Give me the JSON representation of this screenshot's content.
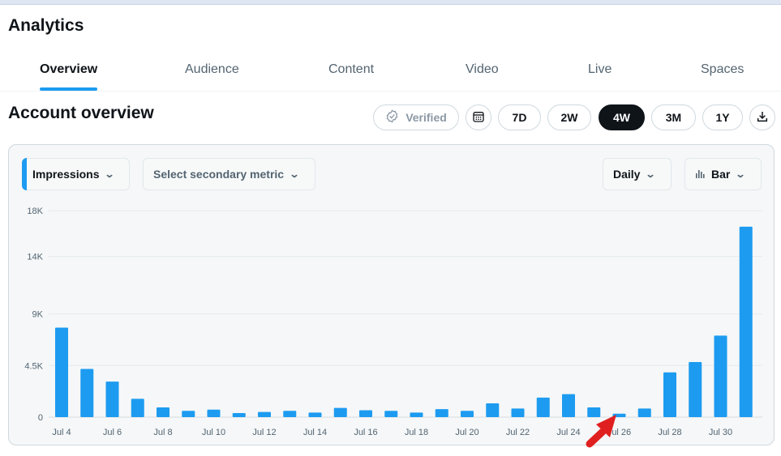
{
  "app": {
    "title": "Analytics"
  },
  "tabs": [
    {
      "label": "Overview",
      "active": true
    },
    {
      "label": "Audience",
      "active": false
    },
    {
      "label": "Content",
      "active": false
    },
    {
      "label": "Video",
      "active": false
    },
    {
      "label": "Live",
      "active": false
    },
    {
      "label": "Spaces",
      "active": false
    }
  ],
  "overview": {
    "title": "Account overview",
    "verified_label": "Verified",
    "ranges": [
      "7D",
      "2W",
      "4W",
      "3M",
      "1Y"
    ],
    "selected_range": "4W",
    "icons": {
      "verified": "verified-check-icon",
      "calendar": "calendar-icon",
      "download": "download-icon"
    }
  },
  "controls": {
    "primary_metric": "Impressions",
    "secondary_metric_placeholder": "Select secondary metric",
    "granularity": "Daily",
    "chart_type_label": "Bar",
    "accent_color": "#1d9bf0"
  },
  "chart_data": {
    "type": "bar",
    "y_ticks": [
      "18K",
      "14K",
      "9K",
      "4.5K",
      "0"
    ],
    "y_tick_values": [
      18000,
      14000,
      9000,
      4500,
      0
    ],
    "ylim": [
      0,
      18000
    ],
    "x_tick_labels": [
      "Jul 4",
      "Jul 6",
      "Jul 8",
      "Jul 10",
      "Jul 12",
      "Jul 14",
      "Jul 16",
      "Jul 18",
      "Jul 20",
      "Jul 22",
      "Jul 24",
      "Jul 26",
      "Jul 28",
      "Jul 30"
    ],
    "categories": [
      "Jul 4",
      "Jul 5",
      "Jul 6",
      "Jul 7",
      "Jul 8",
      "Jul 9",
      "Jul 10",
      "Jul 11",
      "Jul 12",
      "Jul 13",
      "Jul 14",
      "Jul 15",
      "Jul 16",
      "Jul 17",
      "Jul 18",
      "Jul 19",
      "Jul 20",
      "Jul 21",
      "Jul 22",
      "Jul 23",
      "Jul 24",
      "Jul 25",
      "Jul 26",
      "Jul 27",
      "Jul 28",
      "Jul 29",
      "Jul 30",
      "Jul 31"
    ],
    "values": [
      7800,
      4200,
      3100,
      1600,
      850,
      550,
      650,
      350,
      450,
      550,
      400,
      800,
      600,
      550,
      400,
      700,
      550,
      1200,
      750,
      1700,
      2000,
      850,
      300,
      750,
      3900,
      4800,
      7100,
      16600
    ],
    "bar_color": "#1d9bf0",
    "grid": true,
    "annotation": "red-arrow-pointer"
  }
}
